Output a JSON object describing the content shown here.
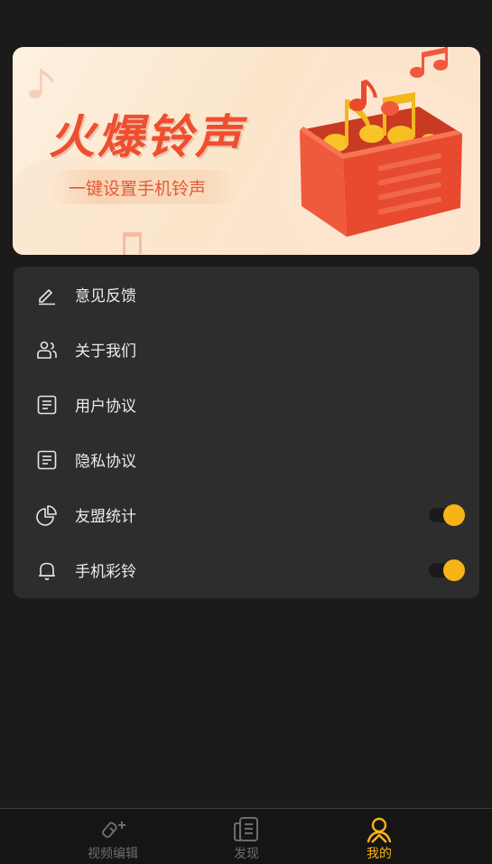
{
  "banner": {
    "title": "火爆铃声",
    "subtitle": "一键设置手机铃声"
  },
  "menu": {
    "items": [
      {
        "label": "意见反馈",
        "icon": "edit-icon"
      },
      {
        "label": "关于我们",
        "icon": "users-icon"
      },
      {
        "label": "用户协议",
        "icon": "document-icon"
      },
      {
        "label": "隐私协议",
        "icon": "document-icon"
      },
      {
        "label": "友盟统计",
        "icon": "pie-chart-icon",
        "toggle_on": true
      },
      {
        "label": "手机彩铃",
        "icon": "bell-icon",
        "toggle_on": true
      }
    ]
  },
  "nav": {
    "items": [
      {
        "label": "视频编辑",
        "icon": "video-edit-icon",
        "active": false
      },
      {
        "label": "发现",
        "icon": "discover-icon",
        "active": false
      },
      {
        "label": "我的",
        "icon": "profile-icon",
        "active": true
      }
    ]
  },
  "colors": {
    "accent": "#f7b416",
    "background": "#1b1b1b",
    "card": "#2d2d2d",
    "banner_title": "#ee4f2f"
  }
}
